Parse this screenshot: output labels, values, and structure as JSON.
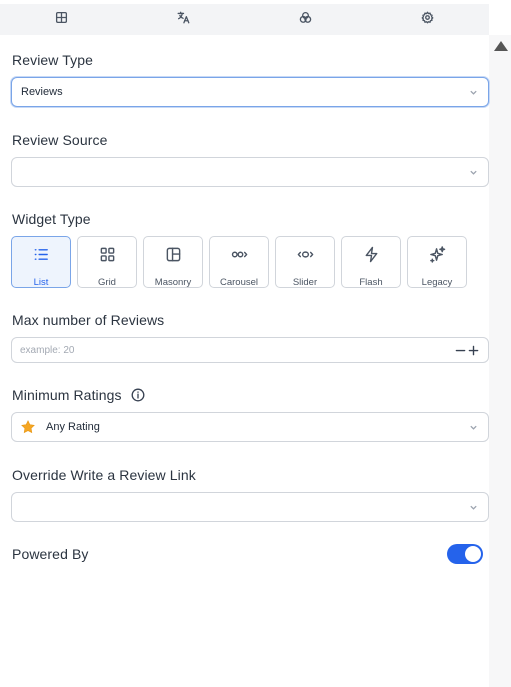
{
  "tabs": [
    {
      "icon": "layout-grid-icon"
    },
    {
      "icon": "translate-icon"
    },
    {
      "icon": "color-circles-icon"
    },
    {
      "icon": "gear-icon"
    }
  ],
  "review_type": {
    "label": "Review Type",
    "value": "Reviews"
  },
  "review_source": {
    "label": "Review Source",
    "value": ""
  },
  "widget_type": {
    "label": "Widget Type",
    "selected": "List",
    "options": [
      {
        "label": "List",
        "icon": "list-icon"
      },
      {
        "label": "Grid",
        "icon": "grid-icon"
      },
      {
        "label": "Masonry",
        "icon": "masonry-icon"
      },
      {
        "label": "Carousel",
        "icon": "carousel-icon"
      },
      {
        "label": "Slider",
        "icon": "slider-icon"
      },
      {
        "label": "Flash",
        "icon": "flash-icon"
      },
      {
        "label": "Legacy",
        "icon": "sparkles-icon"
      }
    ]
  },
  "max_reviews": {
    "label": "Max number of Reviews",
    "placeholder": "example: 20",
    "value": ""
  },
  "min_ratings": {
    "label": "Minimum Ratings",
    "value": "Any Rating",
    "icon": "star-icon",
    "star_color": "#f5a623"
  },
  "override_link": {
    "label": "Override Write a Review Link",
    "value": ""
  },
  "powered_by": {
    "label": "Powered By",
    "enabled": true,
    "toggle_color": "#2563eb"
  },
  "colors": {
    "accent": "#2563eb",
    "selected_bg": "#eef4fd"
  }
}
